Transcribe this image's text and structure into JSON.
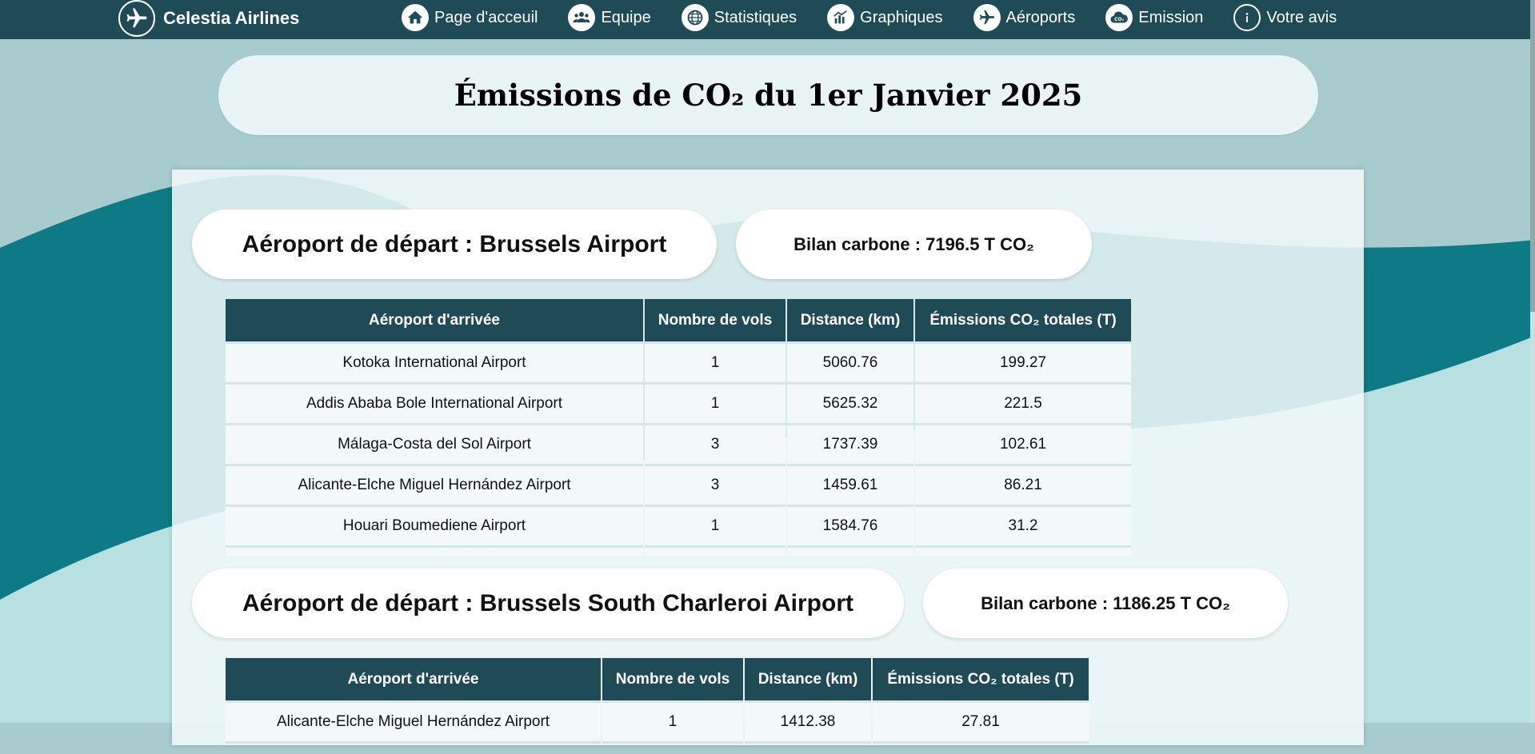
{
  "brand": {
    "name": "Celestia Airlines",
    "logo_icon": "airplane-icon"
  },
  "nav": [
    {
      "label": "Page d'acceuil",
      "icon": "home-icon"
    },
    {
      "label": "Equipe",
      "icon": "team-icon"
    },
    {
      "label": "Statistiques",
      "icon": "globe-stats-icon"
    },
    {
      "label": "Graphiques",
      "icon": "chart-icon"
    },
    {
      "label": "Aéroports",
      "icon": "airplane-icon"
    },
    {
      "label": "Emission",
      "icon": "co2-cloud-icon"
    },
    {
      "label": "Votre avis",
      "icon": "info-icon"
    }
  ],
  "page_title": "Émissions de CO₂ du 1er Janvier 2025",
  "colors": {
    "nav_bg": "#1f4b56",
    "header_bg": "#1f4b56",
    "wave_dark": "#0e7a85",
    "wave_light": "#b5dedf",
    "page_bg": "#a8cccd"
  },
  "table_headers": [
    "Aéroport d'arrivée",
    "Nombre de vols",
    "Distance (km)",
    "Émissions CO₂ totales (T)"
  ],
  "sections": [
    {
      "departure_label": "Aéroport de départ : Brussels Airport",
      "bilan_label": "Bilan carbone : 7196.5 T CO₂",
      "rows": [
        {
          "airport": "Kotoka International Airport",
          "flights": "1",
          "distance": "5060.76",
          "emissions": "199.27"
        },
        {
          "airport": "Addis Ababa Bole International Airport",
          "flights": "1",
          "distance": "5625.32",
          "emissions": "221.5"
        },
        {
          "airport": "Málaga-Costa del Sol Airport",
          "flights": "3",
          "distance": "1737.39",
          "emissions": "102.61"
        },
        {
          "airport": "Alicante-Elche Miguel Hernández Airport",
          "flights": "3",
          "distance": "1459.61",
          "emissions": "86.21"
        },
        {
          "airport": "Houari Boumediene Airport",
          "flights": "1",
          "distance": "1584.76",
          "emissions": "31.2"
        }
      ]
    },
    {
      "departure_label": "Aéroport de départ : Brussels South Charleroi Airport",
      "bilan_label": "Bilan carbone : 1186.25 T CO₂",
      "rows": [
        {
          "airport": "Alicante-Elche Miguel Hernández Airport",
          "flights": "1",
          "distance": "1412.38",
          "emissions": "27.81"
        }
      ]
    }
  ]
}
